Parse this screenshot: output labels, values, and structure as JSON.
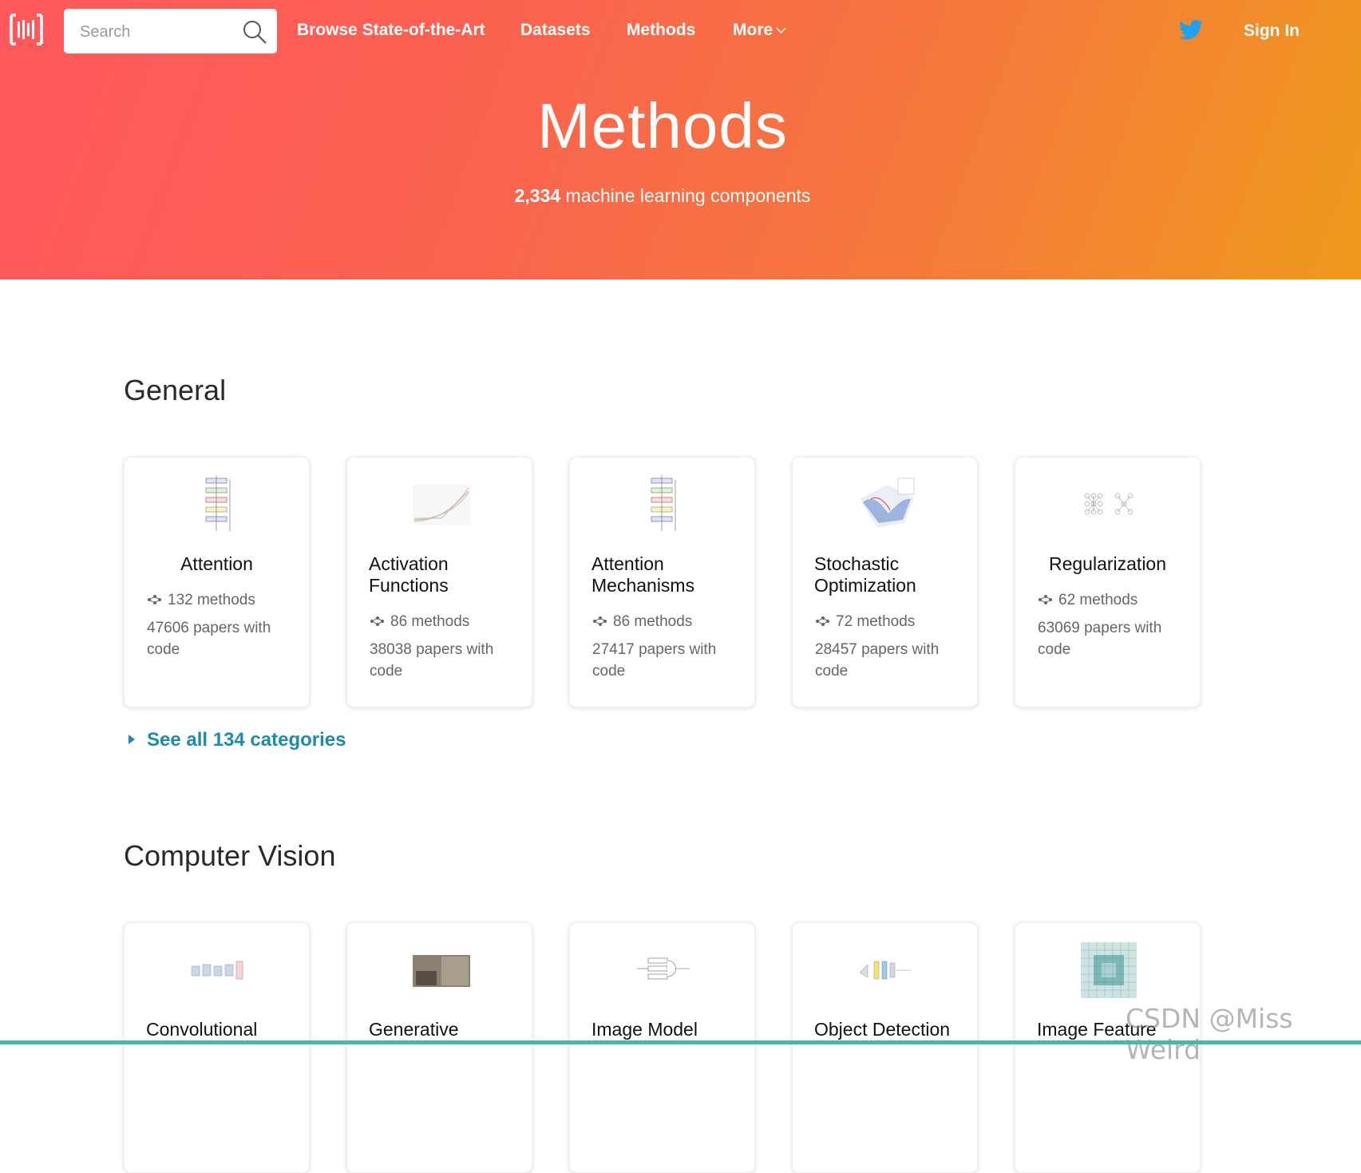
{
  "header": {
    "search_placeholder": "Search",
    "nav": {
      "browse": "Browse State-of-the-Art",
      "datasets": "Datasets",
      "methods": "Methods",
      "more": "More"
    },
    "sign_in": "Sign In",
    "icons": {
      "logo": "papers-with-code-logo",
      "search": "search-icon",
      "twitter": "twitter-icon",
      "more": "chevron-down-icon"
    }
  },
  "hero": {
    "title": "Methods",
    "count": "2,334",
    "subtitle": "machine learning components"
  },
  "sections": {
    "general": {
      "title": "General",
      "cards": [
        {
          "name": "Attention",
          "methods": "132 methods",
          "papers": "47606 papers with code"
        },
        {
          "name": "Activation Functions",
          "methods": "86 methods",
          "papers": "38038 papers with code"
        },
        {
          "name": "Attention Mechanisms",
          "methods": "86 methods",
          "papers": "27417 papers with code"
        },
        {
          "name": "Stochastic Optimization",
          "methods": "72 methods",
          "papers": "28457 papers with code"
        },
        {
          "name": "Regularization",
          "methods": "62 methods",
          "papers": "63069 papers with code"
        }
      ],
      "see_all": "See all 134 categories"
    },
    "cv": {
      "title": "Computer Vision",
      "cards": [
        {
          "name": "Convolutional"
        },
        {
          "name": "Generative"
        },
        {
          "name": "Image Model"
        },
        {
          "name": "Object Detection"
        },
        {
          "name": "Image Feature"
        }
      ]
    }
  },
  "colors": {
    "gradient_start": "#ff585c",
    "gradient_end": "#ef9a1c",
    "link": "#1a8bb3",
    "bottom_bar": "#48b9a8"
  },
  "watermark": "CSDN @Miss Weird"
}
